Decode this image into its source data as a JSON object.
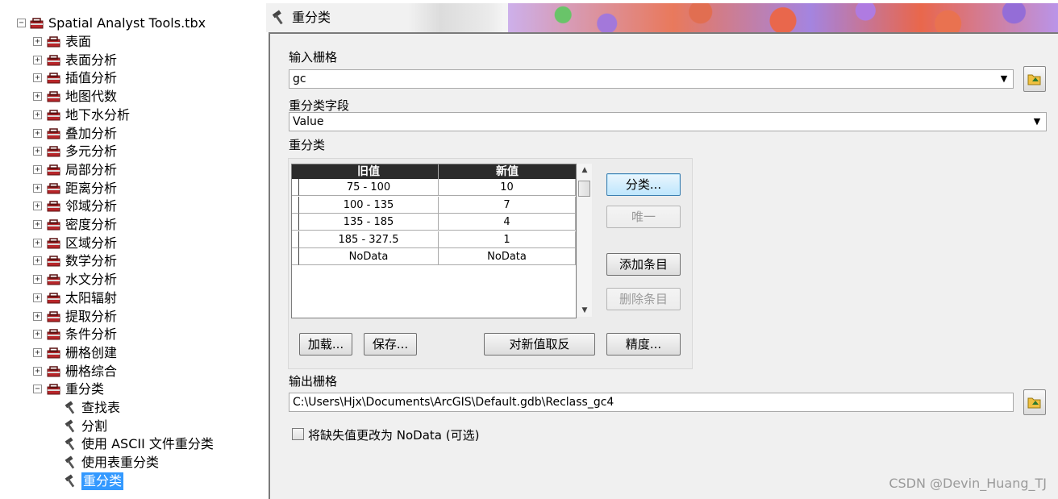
{
  "tree": {
    "root_label": "Spatial Analyst Tools.tbx",
    "toolsets": [
      "表面",
      "表面分析",
      "插值分析",
      "地图代数",
      "地下水分析",
      "叠加分析",
      "多元分析",
      "局部分析",
      "距离分析",
      "邻域分析",
      "密度分析",
      "区域分析",
      "数学分析",
      "水文分析",
      "太阳辐射",
      "提取分析",
      "条件分析",
      "栅格创建",
      "栅格综合"
    ],
    "expanded_toolset": "重分类",
    "tools": [
      "查找表",
      "分割",
      "使用 ASCII 文件重分类",
      "使用表重分类",
      "重分类"
    ],
    "selected_tool": "重分类"
  },
  "dialog": {
    "title": "重分类",
    "input_raster_label": "输入栅格",
    "input_raster_value": "gc",
    "reclass_field_label": "重分类字段",
    "reclass_field_value": "Value",
    "reclassification_label": "重分类",
    "table": {
      "headers": [
        "旧值",
        "新值"
      ],
      "rows": [
        [
          "75 - 100",
          "10"
        ],
        [
          "100 - 135",
          "7"
        ],
        [
          "135 - 185",
          "4"
        ],
        [
          "185 - 327.5",
          "1"
        ],
        [
          "NoData",
          "NoData"
        ]
      ]
    },
    "buttons": {
      "classify": "分类...",
      "unique": "唯一",
      "add_entry": "添加条目",
      "delete_entry": "删除条目",
      "load": "加载...",
      "save": "保存...",
      "reverse": "对新值取反",
      "precision": "精度..."
    },
    "output_raster_label": "输出栅格",
    "output_raster_value": "C:\\Users\\Hjx\\Documents\\ArcGIS\\Default.gdb\\Reclass_gc4",
    "missing_values_label": "将缺失值更改为 NoData (可选)",
    "missing_values_checked": false
  },
  "watermark": "CSDN @Devin_Huang_TJ"
}
